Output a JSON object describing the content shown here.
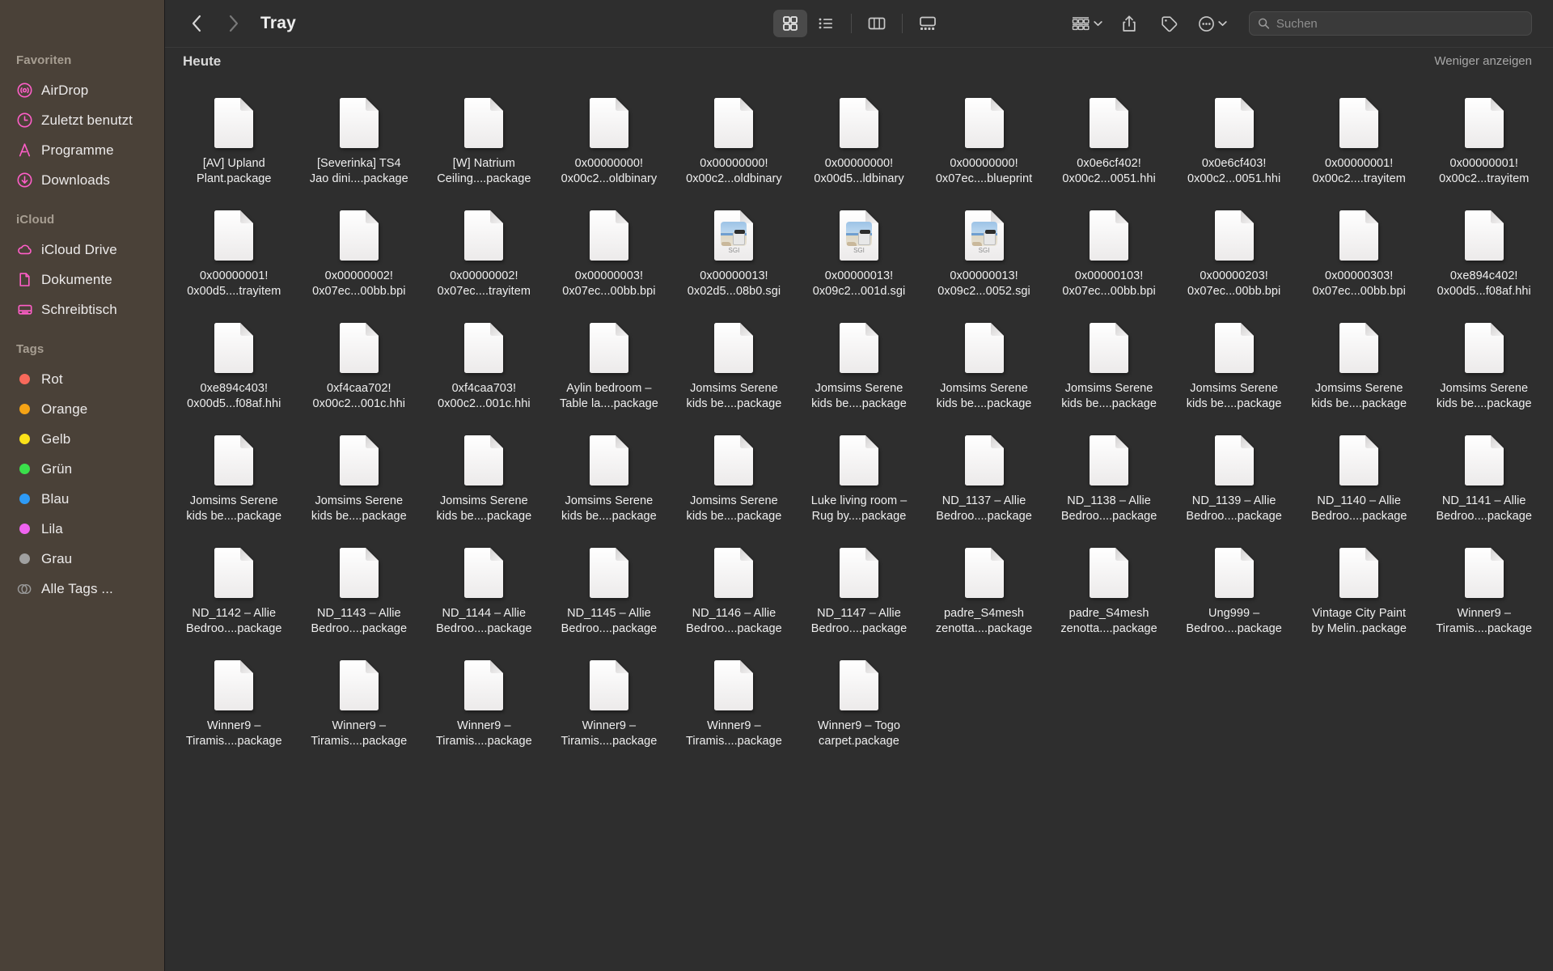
{
  "sidebar": {
    "groups": [
      {
        "title": "Favoriten",
        "items": [
          {
            "label": "AirDrop",
            "icon": "airdrop-icon"
          },
          {
            "label": "Zuletzt benutzt",
            "icon": "clock-icon"
          },
          {
            "label": "Programme",
            "icon": "applications-icon"
          },
          {
            "label": "Downloads",
            "icon": "download-icon"
          }
        ]
      },
      {
        "title": "iCloud",
        "items": [
          {
            "label": "iCloud Drive",
            "icon": "cloud-icon"
          },
          {
            "label": "Dokumente",
            "icon": "document-icon"
          },
          {
            "label": "Schreibtisch",
            "icon": "desktop-icon"
          }
        ]
      },
      {
        "title": "Tags",
        "items": [
          {
            "label": "Rot",
            "icon": "tag-dot-icon",
            "color": "#f8695b"
          },
          {
            "label": "Orange",
            "icon": "tag-dot-icon",
            "color": "#f5a315"
          },
          {
            "label": "Gelb",
            "icon": "tag-dot-icon",
            "color": "#fbe219"
          },
          {
            "label": "Grün",
            "icon": "tag-dot-icon",
            "color": "#3ae04b"
          },
          {
            "label": "Blau",
            "icon": "tag-dot-icon",
            "color": "#2e9bf7"
          },
          {
            "label": "Lila",
            "icon": "tag-dot-icon",
            "color": "#f063f0"
          },
          {
            "label": "Grau",
            "icon": "tag-dot-icon",
            "color": "#a0a0a0"
          },
          {
            "label": "Alle Tags ...",
            "icon": "all-tags-icon",
            "color": "#9a9a9a"
          }
        ]
      }
    ]
  },
  "toolbar": {
    "title": "Tray",
    "back_icon": "chevron-left-icon",
    "forward_icon": "chevron-right-icon",
    "views": [
      {
        "name": "icon-view",
        "icon": "grid-icon",
        "active": true
      },
      {
        "name": "list-view",
        "icon": "list-icon",
        "active": false
      },
      {
        "name": "column-view",
        "icon": "columns-icon",
        "active": false
      },
      {
        "name": "gallery-view",
        "icon": "gallery-icon",
        "active": false
      }
    ],
    "group_button": {
      "icon": "group-by-icon",
      "chevron": "chevron-down-icon"
    },
    "share_button": {
      "icon": "share-icon"
    },
    "tag_button": {
      "icon": "tag-icon"
    },
    "more_button": {
      "icon": "ellipsis-circle-icon",
      "chevron": "chevron-down-icon"
    }
  },
  "search": {
    "placeholder": "Suchen",
    "value": "",
    "icon": "search-icon"
  },
  "group_header": {
    "title": "Heute",
    "show_less": "Weniger anzeigen"
  },
  "files": [
    {
      "name": "[AV] Upland\nPlant.package",
      "kind": "document"
    },
    {
      "name": "[Severinka] TS4\nJao dini....package",
      "kind": "document"
    },
    {
      "name": "[W] Natrium\nCeiling....package",
      "kind": "document"
    },
    {
      "name": "0x00000000!\n0x00c2...oldbinary",
      "kind": "document"
    },
    {
      "name": "0x00000000!\n0x00c2...oldbinary",
      "kind": "document"
    },
    {
      "name": "0x00000000!\n0x00d5...ldbinary",
      "kind": "document"
    },
    {
      "name": "0x00000000!\n0x07ec....blueprint",
      "kind": "document"
    },
    {
      "name": "0x0e6cf402!\n0x00c2...0051.hhi",
      "kind": "document"
    },
    {
      "name": "0x0e6cf403!\n0x00c2...0051.hhi",
      "kind": "document"
    },
    {
      "name": "0x00000001!\n0x00c2....trayitem",
      "kind": "document"
    },
    {
      "name": "0x00000001!\n0x00c2...trayitem",
      "kind": "document"
    },
    {
      "name": "0x00000001!\n0x00d5....trayitem",
      "kind": "document"
    },
    {
      "name": "0x00000002!\n0x07ec...00bb.bpi",
      "kind": "document"
    },
    {
      "name": "0x00000002!\n0x07ec....trayitem",
      "kind": "document"
    },
    {
      "name": "0x00000003!\n0x07ec...00bb.bpi",
      "kind": "document"
    },
    {
      "name": "0x00000013!\n0x02d5...08b0.sgi",
      "kind": "sgi"
    },
    {
      "name": "0x00000013!\n0x09c2...001d.sgi",
      "kind": "sgi"
    },
    {
      "name": "0x00000013!\n0x09c2...0052.sgi",
      "kind": "sgi"
    },
    {
      "name": "0x00000103!\n0x07ec...00bb.bpi",
      "kind": "document"
    },
    {
      "name": "0x00000203!\n0x07ec...00bb.bpi",
      "kind": "document"
    },
    {
      "name": "0x00000303!\n0x07ec...00bb.bpi",
      "kind": "document"
    },
    {
      "name": "0xe894c402!\n0x00d5...f08af.hhi",
      "kind": "document"
    },
    {
      "name": "0xe894c403!\n0x00d5...f08af.hhi",
      "kind": "document"
    },
    {
      "name": "0xf4caa702!\n0x00c2...001c.hhi",
      "kind": "document"
    },
    {
      "name": "0xf4caa703!\n0x00c2...001c.hhi",
      "kind": "document"
    },
    {
      "name": "Aylin bedroom –\nTable la....package",
      "kind": "document"
    },
    {
      "name": "Jomsims Serene\nkids be....package",
      "kind": "document"
    },
    {
      "name": "Jomsims Serene\nkids be....package",
      "kind": "document"
    },
    {
      "name": "Jomsims Serene\nkids be....package",
      "kind": "document"
    },
    {
      "name": "Jomsims Serene\nkids be....package",
      "kind": "document"
    },
    {
      "name": "Jomsims Serene\nkids be....package",
      "kind": "document"
    },
    {
      "name": "Jomsims Serene\nkids be....package",
      "kind": "document"
    },
    {
      "name": "Jomsims Serene\nkids be....package",
      "kind": "document"
    },
    {
      "name": "Jomsims Serene\nkids be....package",
      "kind": "document"
    },
    {
      "name": "Jomsims Serene\nkids be....package",
      "kind": "document"
    },
    {
      "name": "Jomsims Serene\nkids be....package",
      "kind": "document"
    },
    {
      "name": "Jomsims Serene\nkids be....package",
      "kind": "document"
    },
    {
      "name": "Jomsims Serene\nkids be....package",
      "kind": "document"
    },
    {
      "name": "Luke living room –\nRug by....package",
      "kind": "document"
    },
    {
      "name": "ND_1137 – Allie\nBedroo....package",
      "kind": "document"
    },
    {
      "name": "ND_1138 – Allie\nBedroo....package",
      "kind": "document"
    },
    {
      "name": "ND_1139 – Allie\nBedroo....package",
      "kind": "document"
    },
    {
      "name": "ND_1140 – Allie\nBedroo....package",
      "kind": "document"
    },
    {
      "name": "ND_1141 – Allie\nBedroo....package",
      "kind": "document"
    },
    {
      "name": "ND_1142 – Allie\nBedroo....package",
      "kind": "document"
    },
    {
      "name": "ND_1143 – Allie\nBedroo....package",
      "kind": "document"
    },
    {
      "name": "ND_1144 – Allie\nBedroo....package",
      "kind": "document"
    },
    {
      "name": "ND_1145 – Allie\nBedroo....package",
      "kind": "document"
    },
    {
      "name": "ND_1146 – Allie\nBedroo....package",
      "kind": "document"
    },
    {
      "name": "ND_1147 – Allie\nBedroo....package",
      "kind": "document"
    },
    {
      "name": "padre_S4mesh\nzenotta....package",
      "kind": "document"
    },
    {
      "name": "padre_S4mesh\nzenotta....package",
      "kind": "document"
    },
    {
      "name": "Ung999 –\nBedroo....package",
      "kind": "document"
    },
    {
      "name": "Vintage City Paint\nby Melin..package",
      "kind": "document"
    },
    {
      "name": "Winner9 –\nTiramis....package",
      "kind": "document"
    },
    {
      "name": "Winner9 –\nTiramis....package",
      "kind": "document"
    },
    {
      "name": "Winner9 –\nTiramis....package",
      "kind": "document"
    },
    {
      "name": "Winner9 –\nTiramis....package",
      "kind": "document"
    },
    {
      "name": "Winner9 –\nTiramis....package",
      "kind": "document"
    },
    {
      "name": "Winner9 –\nTiramis....package",
      "kind": "document"
    },
    {
      "name": "Winner9 – Togo\ncarpet.package",
      "kind": "document"
    }
  ],
  "sgi_badge_label": "SGI",
  "colors": {
    "sidebar_bg": "#4a4138",
    "main_bg": "#2e2e2e",
    "toolbar_bg": "#2e2e2e",
    "accent_pink": "#ff5ec8",
    "text_primary": "#efefef",
    "text_secondary": "#a8a8a8"
  }
}
